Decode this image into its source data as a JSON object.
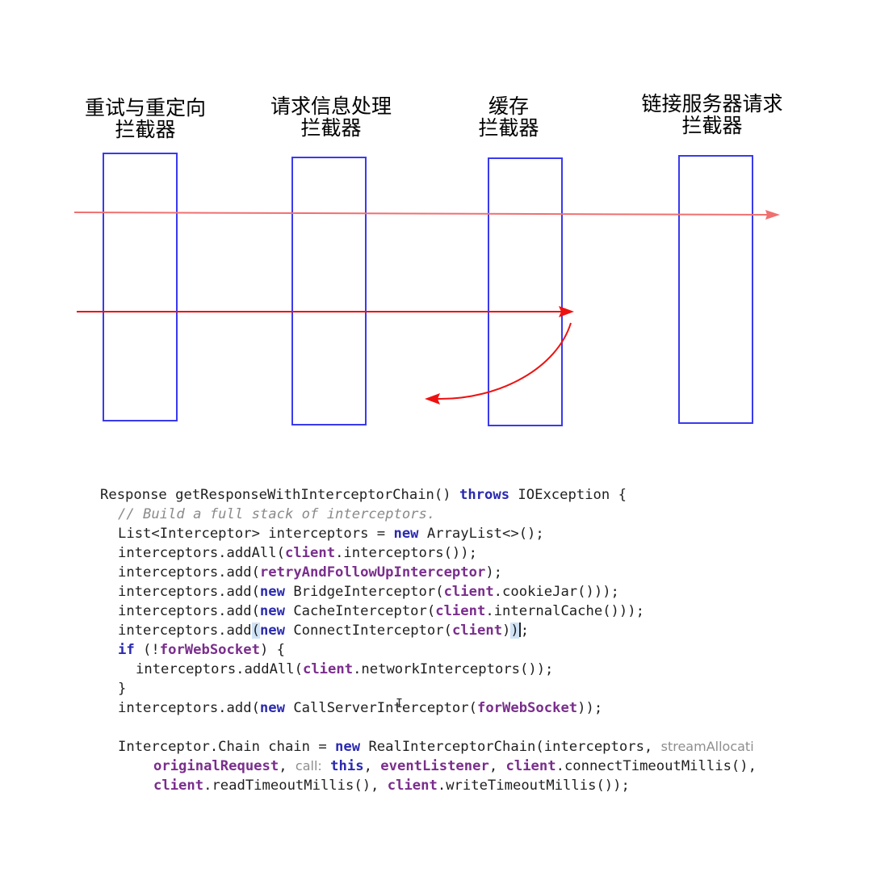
{
  "diagram": {
    "interceptors": [
      {
        "line1": "重试与重定向",
        "line2": "拦截器"
      },
      {
        "line1": "请求信息处理",
        "line2": "拦截器"
      },
      {
        "line1": "缓存",
        "line2": "拦截器"
      },
      {
        "line1": "链接服务器请求",
        "line2": "拦截器"
      }
    ],
    "colors": {
      "box_border": "#3a3aee",
      "arrow": "#ee1111",
      "arrow_light": "#f07070"
    }
  },
  "code": {
    "l1": {
      "a": "Response getResponseWithInterceptorChain() ",
      "kw": "throws",
      "b": " IOException {"
    },
    "l2": {
      "comment": "// Build a full stack of interceptors."
    },
    "l3": {
      "a": "List<Interceptor> interceptors = ",
      "kw": "new",
      "b": " ArrayList<>();"
    },
    "l4": {
      "a": "interceptors.addAll(",
      "f": "client",
      "b": ".interceptors());"
    },
    "l5": {
      "a": "interceptors.add(",
      "f": "retryAndFollowUpInterceptor",
      "b": ");"
    },
    "l6": {
      "a": "interceptors.add(",
      "kw": "new",
      "b": " BridgeInterceptor(",
      "f": "client",
      "c": ".cookieJar()));"
    },
    "l7": {
      "a": "interceptors.add(",
      "kw": "new",
      "b": " CacheInterceptor(",
      "f": "client",
      "c": ".internalCache()));"
    },
    "l8": {
      "a": "interceptors.add",
      "hl1": "(",
      "kw": "new",
      "b": " ConnectInterceptor(",
      "f": "client",
      "c": ")",
      "hl2": ")",
      "d": ";"
    },
    "l9": {
      "kw": "if",
      "a": " (!",
      "f": "forWebSocket",
      "b": ") {"
    },
    "l10": {
      "a": "interceptors.addAll(",
      "f": "client",
      "b": ".networkInterceptors());"
    },
    "l11": {
      "a": "}"
    },
    "l12": {
      "a": "interceptors.add(",
      "kw": "new",
      "b": " CallServerInterceptor(",
      "f": "forWebSocket",
      "c": "));"
    },
    "l13": {
      "a": "Interceptor.Chain chain = ",
      "kw": "new",
      "b": " RealInterceptorChain(interceptors, ",
      "hint": "streamAllocati"
    },
    "l14": {
      "f1": "originalRequest",
      "a": ", ",
      "hint": "call:",
      "kw": "this",
      "b": ", ",
      "f2": "eventListener",
      "c": ", ",
      "f3": "client",
      "d": ".connectTimeoutMillis(),"
    },
    "l15": {
      "f1": "client",
      "a": ".readTimeoutMillis(), ",
      "f2": "client",
      "b": ".writeTimeoutMillis());"
    }
  }
}
